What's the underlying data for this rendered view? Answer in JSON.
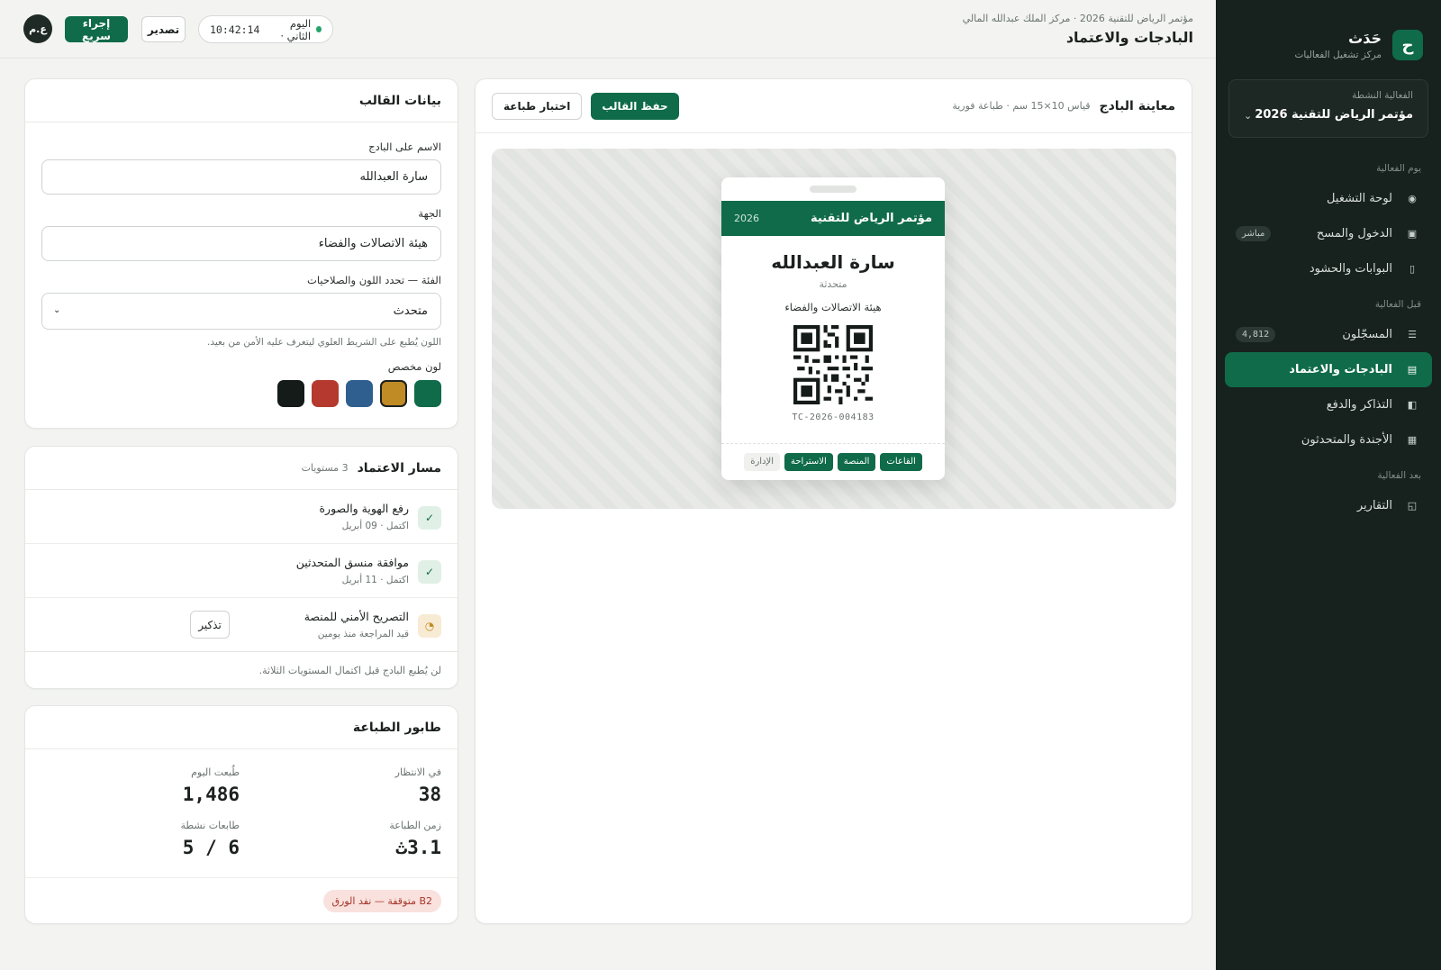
{
  "brand": {
    "logo": "ح",
    "name": "حَدَث",
    "subtitle": "مركز تشغيل الفعاليات"
  },
  "event_select": {
    "label": "الفعالية النشطة",
    "value": "مؤتمر الرياض للتقنية 2026"
  },
  "nav": {
    "sections": [
      {
        "title": "يوم الفعالية",
        "items": [
          {
            "label": "لوحة التشغيل",
            "icon": "dashboard-icon"
          },
          {
            "label": "الدخول والمسح",
            "icon": "scan-icon",
            "badge": "مباشر"
          },
          {
            "label": "البوابات والحشود",
            "icon": "gate-icon"
          }
        ]
      },
      {
        "title": "قبل الفعالية",
        "items": [
          {
            "label": "المسجّلون",
            "icon": "list-icon",
            "badge": "4,812"
          },
          {
            "label": "البادجات والاعتماد",
            "icon": "badge-icon",
            "active": true
          },
          {
            "label": "التذاكر والدفع",
            "icon": "ticket-icon"
          },
          {
            "label": "الأجندة والمتحدثون",
            "icon": "agenda-icon"
          }
        ]
      },
      {
        "title": "بعد الفعالية",
        "items": [
          {
            "label": "التقارير",
            "icon": "report-icon"
          }
        ]
      }
    ]
  },
  "topbar": {
    "breadcrumb": "مؤتمر الرياض للتقنية 2026 · مركز الملك عبدالله المالي",
    "title": "البادجات والاعتماد",
    "day": "اليوم الثاني ·",
    "time": "10:42:14",
    "export_label": "تصدير",
    "quick_label": "إجراء سريع",
    "avatar": "ع.م"
  },
  "preview": {
    "title": "معاينة البادج",
    "subtitle": "قياس 10×15 سم · طباعة فورية",
    "test_print": "اختبار طباعة",
    "save": "حفظ القالب",
    "badge": {
      "event": "مؤتمر الرياض للتقنية",
      "year": "2026",
      "name": "سارة العبدالله",
      "role": "متحدثة",
      "org": "هيئة الاتصالات والفضاء",
      "id": "TC-2026-004183",
      "zones": [
        {
          "label": "القاعات",
          "on": true
        },
        {
          "label": "المنصة",
          "on": true
        },
        {
          "label": "الاستراحة",
          "on": true
        },
        {
          "label": "الإدارة",
          "on": false
        }
      ]
    }
  },
  "template": {
    "title": "بيانات القالب",
    "name_label": "الاسم على البادج",
    "name_value": "سارة العبدالله",
    "org_label": "الجهة",
    "org_value": "هيئة الاتصالات والفضاء",
    "cat_label": "الفئة — تحدد اللون والصلاحيات",
    "cat_value": "متحدث",
    "hint": "اللون يُطبع على الشريط العلوي ليتعرف عليه الأمن من بعيد.",
    "color_label": "لون مخصص",
    "colors": [
      "#0f6b49",
      "#c08a25",
      "#2f5f8f",
      "#b5392e",
      "#151b18"
    ],
    "selected_color": "#c08a25"
  },
  "accreditation": {
    "title": "مسار الاعتماد",
    "levels": "3 مستويات",
    "steps": [
      {
        "title": "رفع الهوية والصورة",
        "sub": "اكتمل · 09 أبريل",
        "status": "done",
        "icon": "✓"
      },
      {
        "title": "موافقة منسق المتحدثين",
        "sub": "اكتمل · 11 أبريل",
        "status": "done",
        "icon": "✓"
      },
      {
        "title": "التصريح الأمني للمنصة",
        "sub": "قيد المراجعة منذ يومين",
        "status": "pend",
        "icon": "◔",
        "action": "تذكير"
      }
    ],
    "note": "لن يُطبع البادج قبل اكتمال المستويات الثلاثة."
  },
  "queue": {
    "title": "طابور الطباعة",
    "waiting_label": "في الانتظار",
    "waiting_value": "38",
    "printed_label": "طُبعت اليوم",
    "printed_value": "1,486",
    "time_label": "زمن الطباعة",
    "time_value": "3.1ث",
    "printers_label": "طابعات نشطة",
    "printers_value": "5 / 6",
    "warning": "B2 متوقفة — نفد الورق"
  }
}
